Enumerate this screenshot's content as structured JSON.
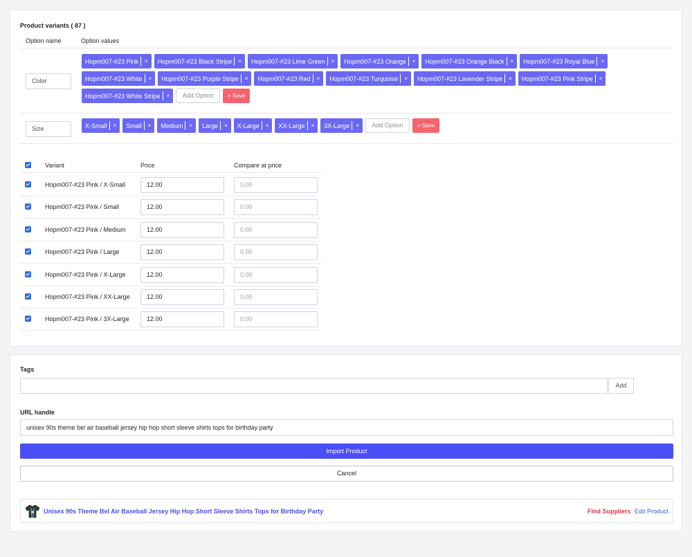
{
  "variants_section": {
    "title": "Product variants ( 87 )",
    "col_option_name": "Option name",
    "col_option_values": "Option values",
    "color_option": {
      "name": "Color",
      "values": [
        "Hopm007-#23 Pink",
        "Hopm007-#23 Black Stripe",
        "Hopm007-#23 Lime Green",
        "Hopm007-#23 Orange",
        "Hopm007-#23 Orange Black",
        "Hopm007-#23 Royal Blue",
        "Hopm007-#23 White",
        "Hopm007-#23 Purple Stripe",
        "Hopm007-#23 Red",
        "Hopm007-#23 Turquoise",
        "Hopm007-#23 Lavender Stripe",
        "Hopm007-#23 Pink Stripe",
        "Hopm007-#23 White Stripe"
      ]
    },
    "size_option": {
      "name": "Size",
      "values": [
        "X-Small",
        "Small",
        "Medium",
        "Large",
        "X-Large",
        "XX-Large",
        "3X-Large"
      ]
    },
    "remove_glyph": "×",
    "add_option_placeholder": "Add Option",
    "save_label": "+ Save"
  },
  "variants_table": {
    "col_variant": "Variant",
    "col_price": "Price",
    "col_compare": "Compare at price",
    "rows": [
      {
        "name": "Hopm007-#23 Pink / X-Small",
        "price": "12.00",
        "compare": "0.00",
        "checked": true
      },
      {
        "name": "Hopm007-#23 Pink / Small",
        "price": "12.00",
        "compare": "0.00",
        "checked": true
      },
      {
        "name": "Hopm007-#23 Pink / Medium",
        "price": "12.00",
        "compare": "0.00",
        "checked": true
      },
      {
        "name": "Hopm007-#23 Pink / Large",
        "price": "12.00",
        "compare": "0.00",
        "checked": true
      },
      {
        "name": "Hopm007-#23 Pink / X-Large",
        "price": "12.00",
        "compare": "0.00",
        "checked": true
      },
      {
        "name": "Hopm007-#23 Pink / XX-Large",
        "price": "12.00",
        "compare": "0.00",
        "checked": true
      },
      {
        "name": "Hopm007-#23 Pink / 3X-Large",
        "price": "12.00",
        "compare": "0.00",
        "checked": true
      }
    ]
  },
  "tags": {
    "label": "Tags",
    "value": "",
    "add_label": "Add"
  },
  "url_handle": {
    "label": "URL handle",
    "value": "unisex 90s theme bel air baseball jersey hip hop short sleeve shirts tops for birthday party"
  },
  "actions": {
    "import_label": "Import Product",
    "cancel_label": "Cancel"
  },
  "product": {
    "name": "Unisex 90s Theme Bel Air Baseball Jersey Hip Hop Short Sleeve Shirts Tops for Birthday Party",
    "find_suppliers": "Find Suppliers",
    "edit_product": "Edit Product"
  },
  "colors": {
    "chip": "#6a68f2",
    "save": "#f5636f",
    "primary": "#4b4ef5",
    "checkbox": "#2f6fe0",
    "danger_link": "#dc3545"
  }
}
